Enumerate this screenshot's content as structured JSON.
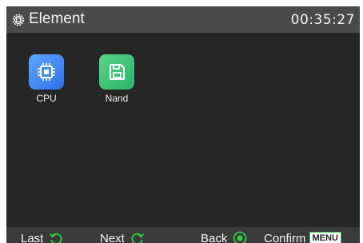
{
  "header": {
    "icon": "gear-chip-icon",
    "title": "Element",
    "time": "00:35:27"
  },
  "apps": [
    {
      "label": "CPU",
      "icon": "cpu-chip-icon",
      "color": "#3b82f6"
    },
    {
      "label": "Nand",
      "icon": "floppy-disk-icon",
      "color": "#34c774"
    }
  ],
  "footer": {
    "last": {
      "label": "Last",
      "icon": "rotate-ccw-icon"
    },
    "next": {
      "label": "Next",
      "icon": "rotate-cw-icon"
    },
    "back": {
      "label": "Back",
      "icon": "radio-target-icon"
    },
    "confirm": {
      "label": "Confirm",
      "key": "MENU"
    }
  },
  "colors": {
    "accent_green": "#2ecc40",
    "background": "#262626",
    "header": "#4a4a4a",
    "footer": "#3a3a3a"
  }
}
